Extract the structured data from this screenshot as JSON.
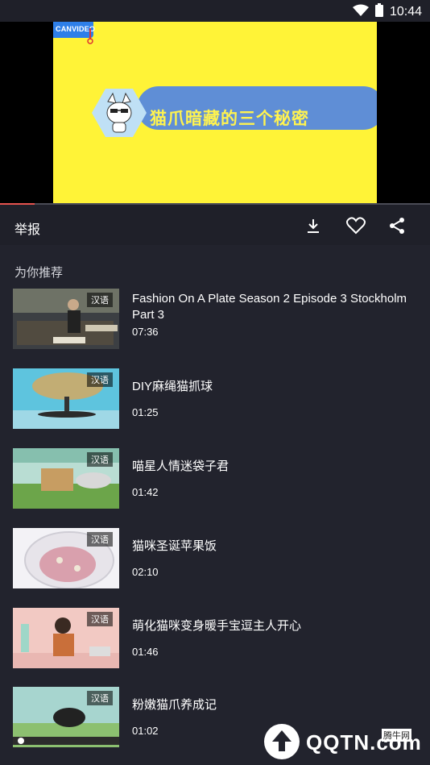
{
  "status": {
    "time": "10:44"
  },
  "player": {
    "brand": "CANVIDEO",
    "title": "猫爪暗藏的三个秘密",
    "progress": 0.08
  },
  "actions": {
    "report_label": "举报",
    "download_icon": "download-icon",
    "like_icon": "heart-icon",
    "share_icon": "share-icon"
  },
  "recommend": {
    "title": "为你推荐",
    "items": [
      {
        "title": "Fashion On A Plate Season 2 Episode 3 Stockholm Part 3",
        "duration": "07:36",
        "badge": "汉语"
      },
      {
        "title": "DIY麻绳猫抓球",
        "duration": "01:25",
        "badge": "汉语"
      },
      {
        "title": "喵星人情迷袋子君",
        "duration": "01:42",
        "badge": "汉语"
      },
      {
        "title": "猫咪圣诞苹果饭",
        "duration": "02:10",
        "badge": "汉语"
      },
      {
        "title": "萌化猫咪变身暖手宝逗主人开心",
        "duration": "01:46",
        "badge": "汉语"
      },
      {
        "title": "粉嫩猫爪养成记",
        "duration": "01:02",
        "badge": "汉语"
      }
    ]
  },
  "watermark": {
    "text": "QQTN.com",
    "sub": "腾牛网"
  }
}
